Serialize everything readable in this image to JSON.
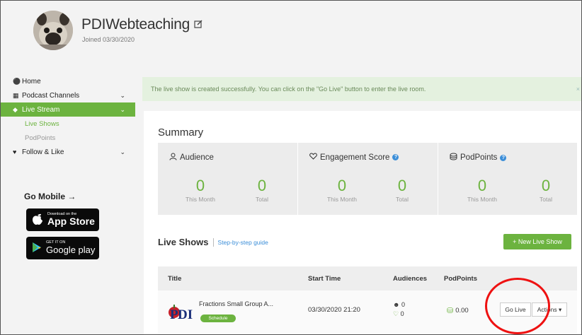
{
  "profile": {
    "username": "PDIWebteaching",
    "edit_icon": "edit-icon",
    "joined": "Joined 03/30/2020"
  },
  "sidebar": {
    "items": [
      {
        "label": "Home",
        "icon": "home-icon"
      },
      {
        "label": "Podcast Channels",
        "icon": "grid-icon"
      },
      {
        "label": "Live Stream",
        "icon": "location-pin-icon"
      },
      {
        "label": "Live Shows"
      },
      {
        "label": "PodPoints"
      },
      {
        "label": "Follow & Like",
        "icon": "heart-icon"
      }
    ],
    "go_mobile": "Go Mobile →",
    "app_store": {
      "small": "Download on the",
      "big": "App Store"
    },
    "google_play": {
      "small": "GET IT ON",
      "big": "Google play"
    }
  },
  "alert": {
    "message": "The live show is created successfully. You can click on the \"Go Live\" button to enter the live room.",
    "close": "×"
  },
  "summary": {
    "title": "Summary",
    "cards": [
      {
        "title": "Audience",
        "icon": "user-icon",
        "month": "0",
        "total": "0",
        "month_label": "This Month",
        "total_label": "Total"
      },
      {
        "title": "Engagement Score",
        "icon": "heart-outline-icon",
        "month": "0",
        "total": "0",
        "month_label": "This Month",
        "total_label": "Total",
        "info": "?"
      },
      {
        "title": "PodPoints",
        "icon": "coins-icon",
        "month": "0",
        "total": "0",
        "month_label": "This Month",
        "total_label": "Total",
        "info": "?"
      }
    ]
  },
  "live_shows": {
    "title": "Live Shows",
    "guide": "Step-by-step guide",
    "new_button": "+ New Live Show",
    "columns": [
      "Title",
      "Start Time",
      "Audiences",
      "PodPoints"
    ],
    "rows": [
      {
        "name": "Fractions Small Group A...",
        "badge": "Schedule",
        "start_time": "03/30/2020 21:20",
        "audiences": "0",
        "likes": "0",
        "podpoints": "0.00",
        "go_live": "Go Live",
        "actions": "Actions ▾"
      }
    ]
  },
  "colors": {
    "accent": "#6cb33f",
    "link": "#3b8ed8",
    "annotation": "#e11111"
  }
}
